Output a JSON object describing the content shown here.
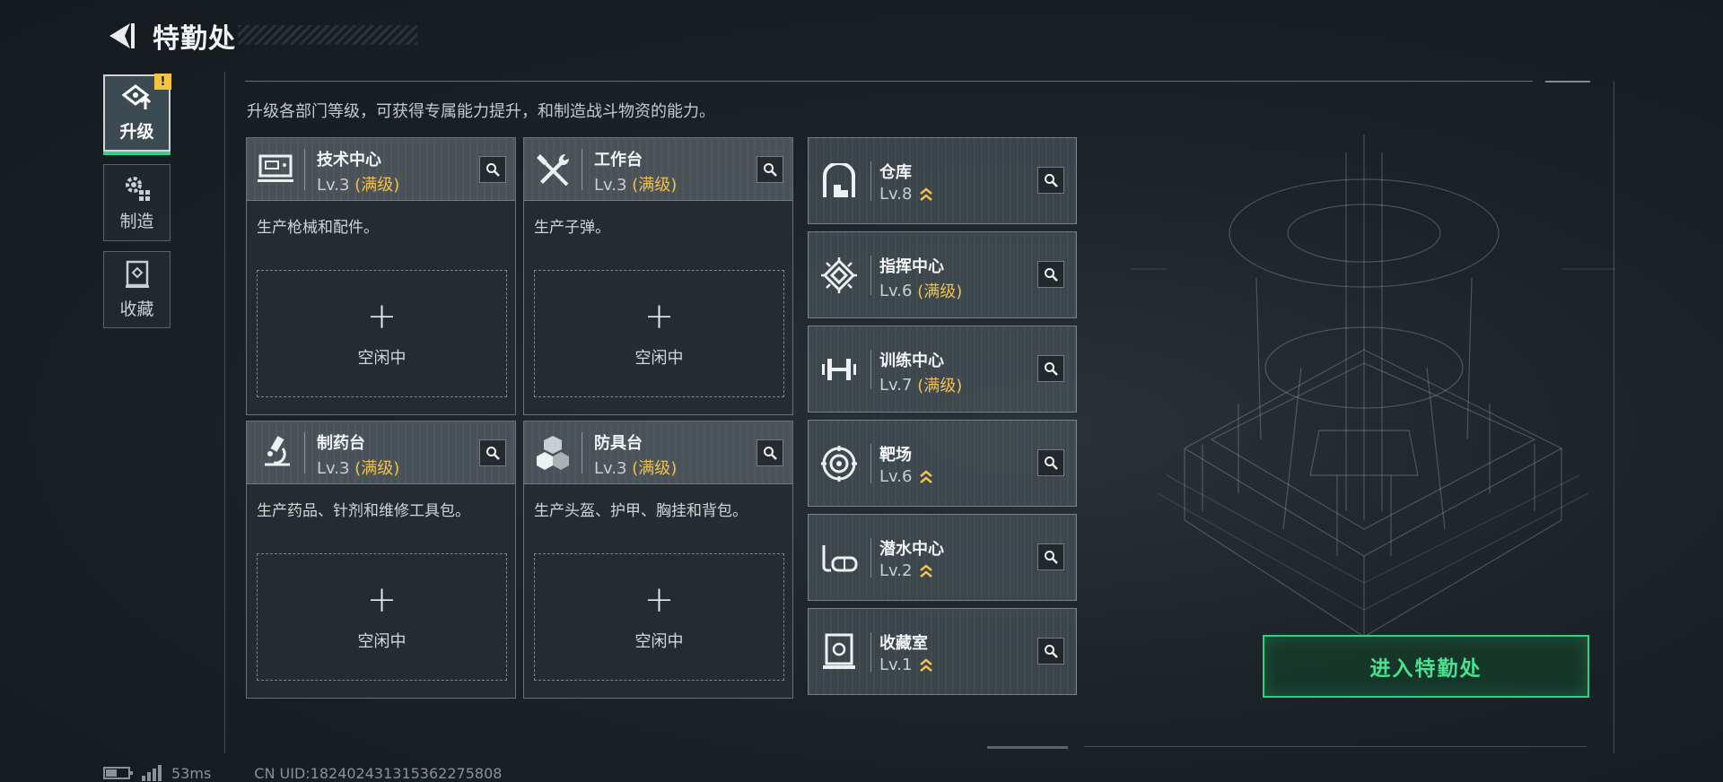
{
  "header": {
    "title": "特勤处"
  },
  "sidebar": {
    "tabs": [
      {
        "label": "升级",
        "active": true,
        "alert": "!"
      },
      {
        "label": "制造",
        "active": false
      },
      {
        "label": "收藏",
        "active": false
      }
    ]
  },
  "description": "升级各部门等级，可获得专属能力提升，和制造战斗物资的能力。",
  "production": [
    {
      "name": "技术中心",
      "level": "Lv.3",
      "status": "(满级)",
      "desc": "生产枪械和配件。",
      "idle_plus": "+",
      "idle_label": "空闲中",
      "icon": "monitor-icon"
    },
    {
      "name": "工作台",
      "level": "Lv.3",
      "status": "(满级)",
      "desc": "生产子弹。",
      "idle_plus": "+",
      "idle_label": "空闲中",
      "icon": "tools-icon"
    },
    {
      "name": "制药台",
      "level": "Lv.3",
      "status": "(满级)",
      "desc": "生产药品、针剂和维修工具包。",
      "idle_plus": "+",
      "idle_label": "空闲中",
      "icon": "microscope-icon"
    },
    {
      "name": "防具台",
      "level": "Lv.3",
      "status": "(满级)",
      "desc": "生产头盔、护甲、胸挂和背包。",
      "idle_plus": "+",
      "idle_label": "空闲中",
      "icon": "cubes-icon"
    }
  ],
  "facilities": [
    {
      "name": "仓库",
      "level": "Lv.8",
      "status": "",
      "upgradable": true,
      "icon": "warehouse-icon"
    },
    {
      "name": "指挥中心",
      "level": "Lv.6",
      "status": "(满级)",
      "upgradable": false,
      "icon": "command-chip-icon"
    },
    {
      "name": "训练中心",
      "level": "Lv.7",
      "status": "(满级)",
      "upgradable": false,
      "icon": "dumbbell-icon"
    },
    {
      "name": "靶场",
      "level": "Lv.6",
      "status": "",
      "upgradable": true,
      "icon": "target-icon"
    },
    {
      "name": "潜水中心",
      "level": "Lv.2",
      "status": "",
      "upgradable": true,
      "icon": "diving-mask-icon"
    },
    {
      "name": "收藏室",
      "level": "Lv.1",
      "status": "",
      "upgradable": true,
      "icon": "collection-icon"
    }
  ],
  "enter_button": {
    "label": "进入特勤处"
  },
  "status_bar": {
    "ping": "53ms",
    "uid": "CN UID:1824024313153622758​08"
  },
  "colors": {
    "accent_green": "#2fd07f",
    "level_gold": "#f1c14e",
    "alert_yellow": "#f5c542"
  }
}
